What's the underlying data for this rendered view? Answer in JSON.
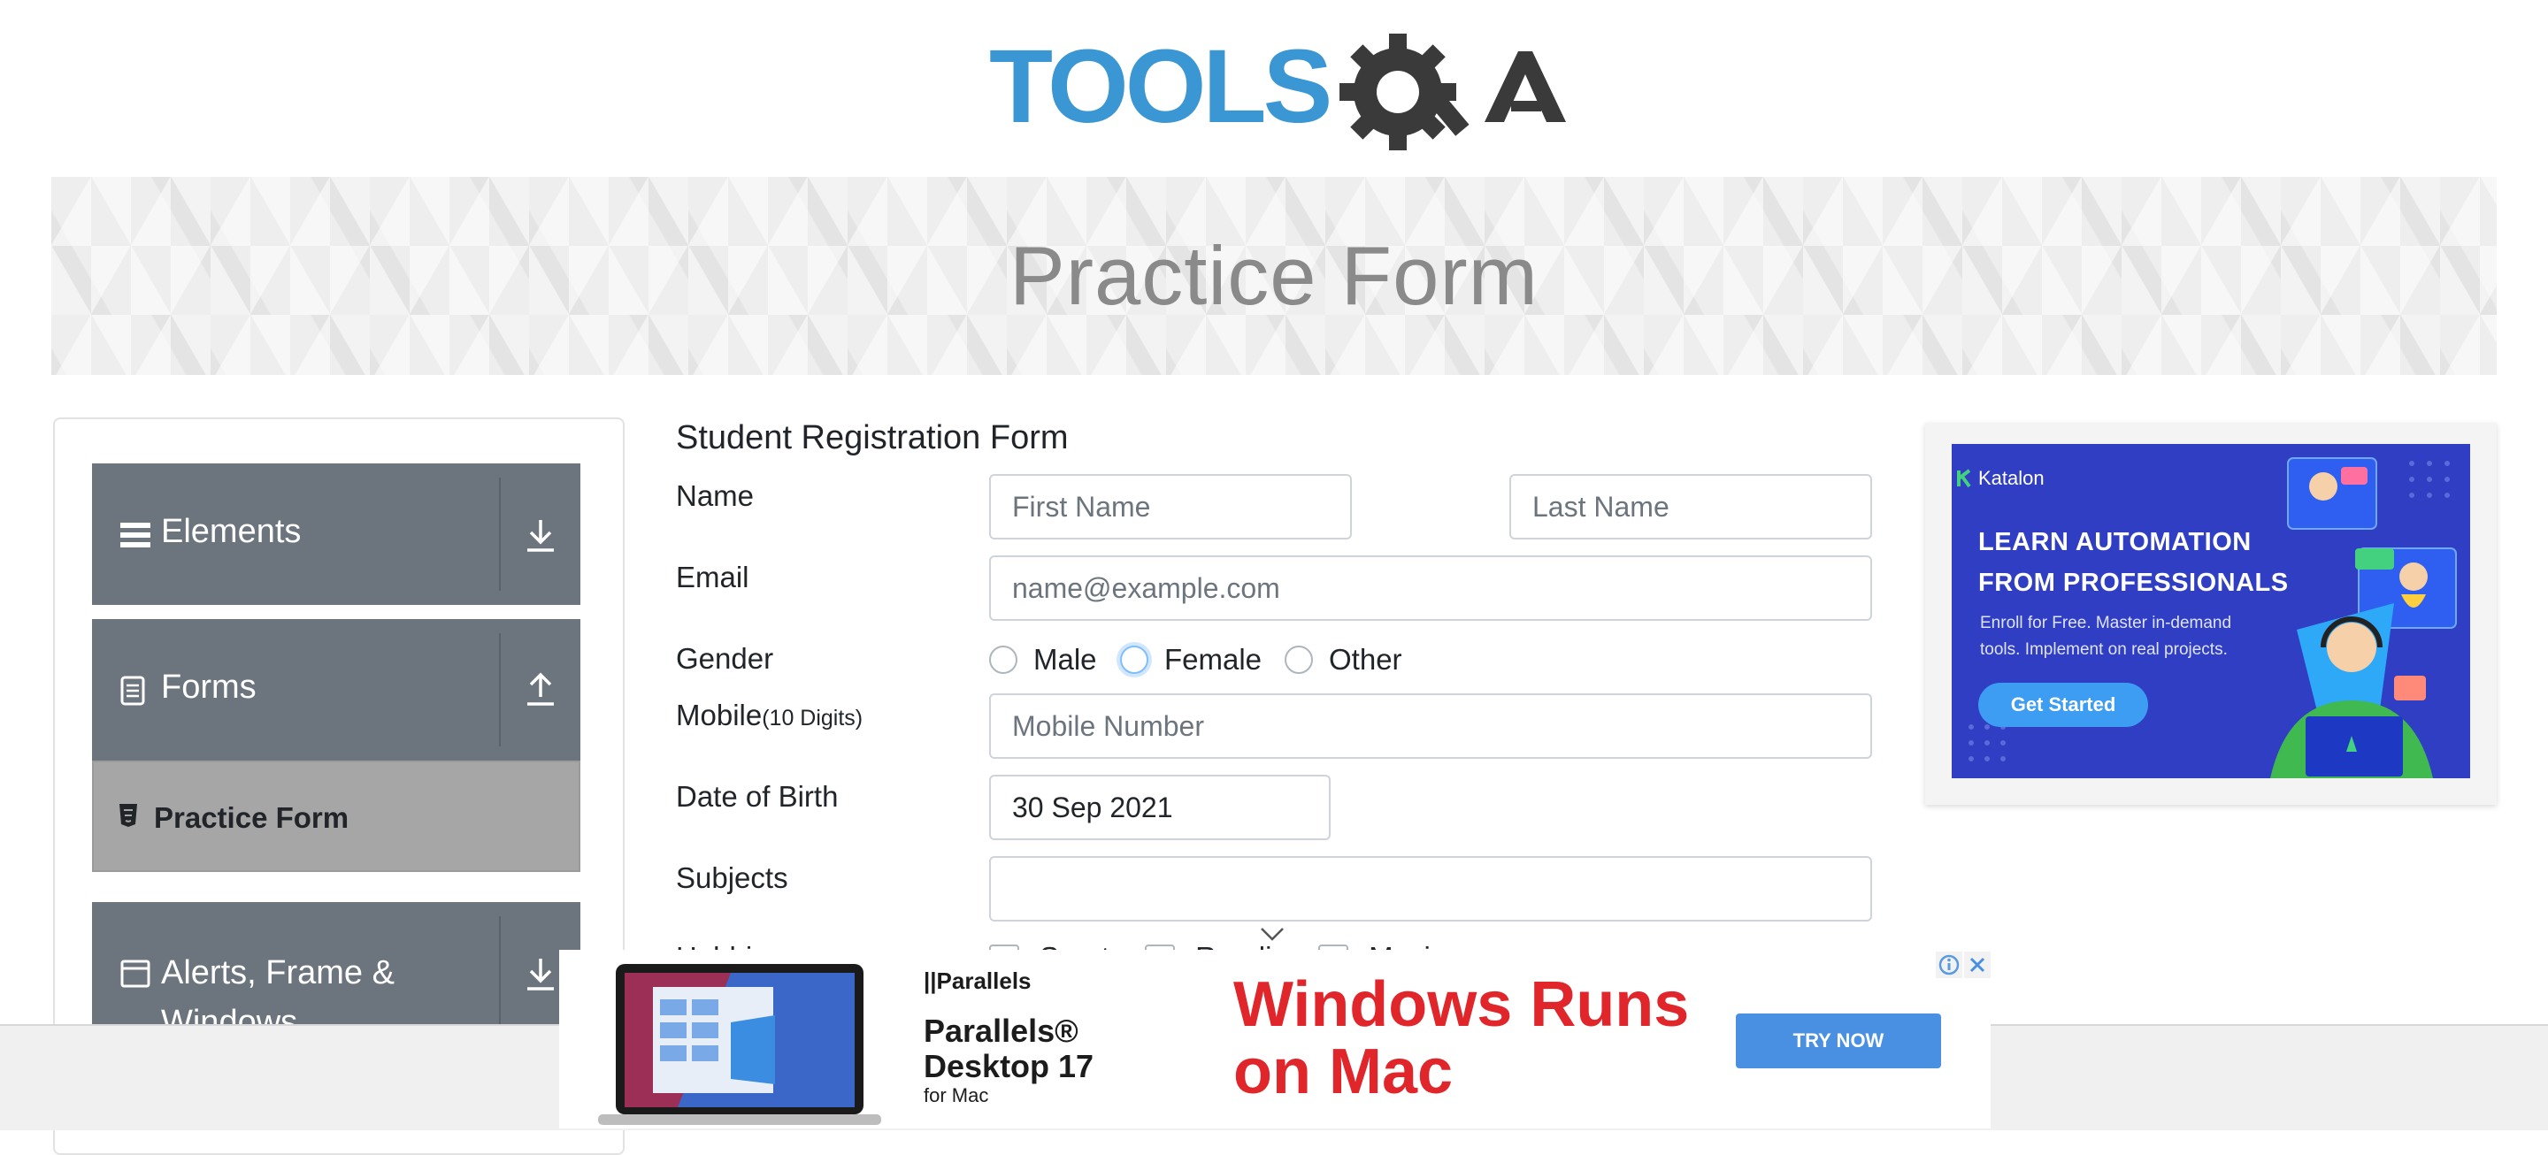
{
  "header": {
    "logo_alt": "TOOLSQA"
  },
  "banner": {
    "title": "Practice Form"
  },
  "sidebar": {
    "groups": [
      {
        "label": "Elements",
        "icon": "list-icon",
        "arrow": "download-icon"
      },
      {
        "label": "Forms",
        "icon": "document-icon",
        "arrow": "upload-icon"
      },
      {
        "label": "Alerts, Frame &",
        "label2": "Windows",
        "icon": "window-icon",
        "arrow": "download-icon"
      }
    ],
    "active_item": {
      "label": "Practice Form",
      "icon": "html5-icon"
    }
  },
  "form": {
    "heading": "Student Registration Form",
    "name_label": "Name",
    "first_name_placeholder": "First Name",
    "last_name_placeholder": "Last Name",
    "email_label": "Email",
    "email_placeholder": "name@example.com",
    "gender_label": "Gender",
    "gender_options": [
      "Male",
      "Female",
      "Other"
    ],
    "mobile_label": "Mobile",
    "mobile_hint": "(10 Digits)",
    "mobile_placeholder": "Mobile Number",
    "dob_label": "Date of Birth",
    "dob_value": "30 Sep 2021",
    "subjects_label": "Subjects",
    "subjects_value": "",
    "hobbies_label": "Hobbies",
    "hobbies_options": [
      "Sports",
      "Reading",
      "Music"
    ]
  },
  "ad_right": {
    "brand": "Katalon",
    "headline": "LEARN AUTOMATION FROM PROFESSIONALS",
    "subtext": "Enroll for Free. Master in-demand tools. Implement on real projects.",
    "cta": "Get Started",
    "bg_color": "#2f3ec2"
  },
  "ad_bottom": {
    "brand": "||Parallels",
    "product": "Parallels® Desktop 17",
    "platform": "for Mac",
    "headline": "Windows Runs on Mac",
    "cta": "TRY NOW",
    "headline_color": "#e0262b",
    "cta_color": "#4a90e2"
  }
}
